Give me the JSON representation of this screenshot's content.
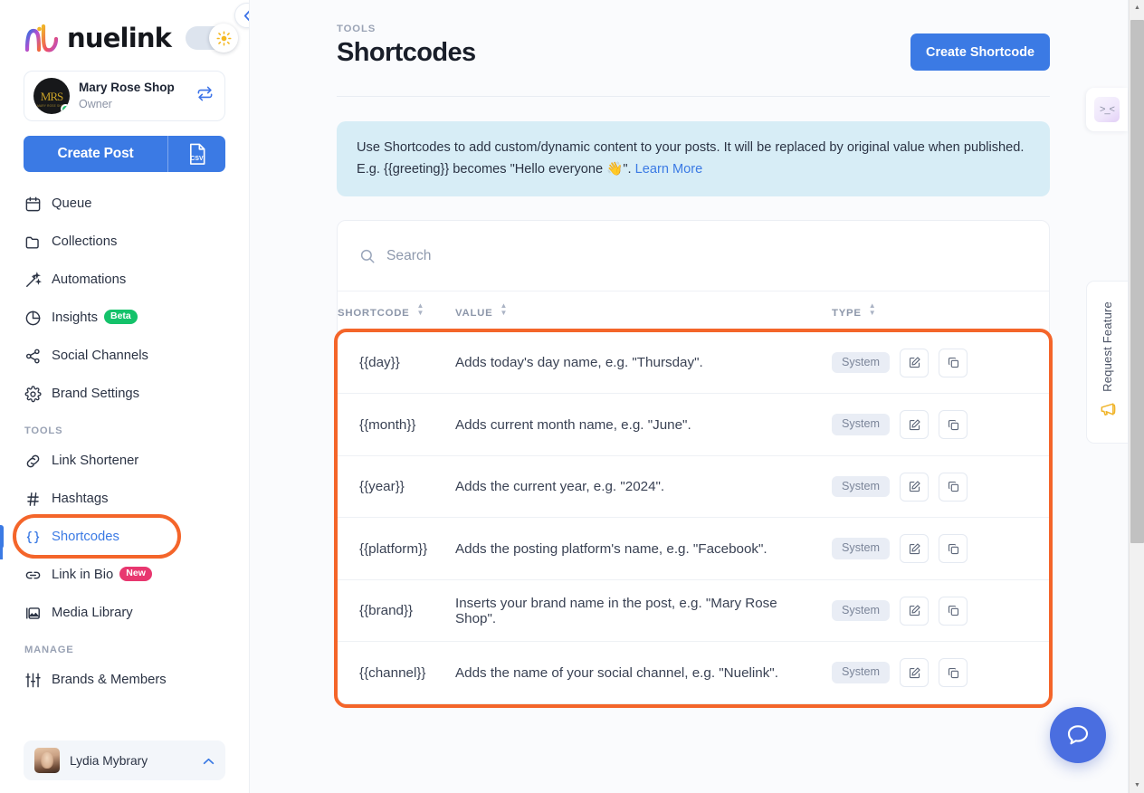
{
  "sidebar": {
    "brand": {
      "name": "nuelink",
      "logo_icon": "nuelink-logo"
    },
    "theme_toggle": {
      "icon": "sun-icon",
      "state": "light"
    },
    "collapse_button": {
      "icon": "chevron-left-icon"
    },
    "account": {
      "name": "Mary Rose Shop",
      "role": "Owner",
      "avatar_initials": "MRS",
      "avatar_sub": "MARY ROSE SHOP",
      "switch_icon": "switch-account-icon",
      "status": "online"
    },
    "create_post": {
      "label": "Create Post",
      "csv_icon": "csv-file-icon"
    },
    "items": [
      {
        "label": "Queue",
        "icon": "calendar-icon"
      },
      {
        "label": "Collections",
        "icon": "folder-icon"
      },
      {
        "label": "Automations",
        "icon": "magic-wand-icon"
      },
      {
        "label": "Insights",
        "icon": "pie-chart-icon",
        "badge": "Beta",
        "badge_color": "#14c26a"
      },
      {
        "label": "Social Channels",
        "icon": "share-nodes-icon"
      },
      {
        "label": "Brand Settings",
        "icon": "gear-icon"
      }
    ],
    "tools_section": "TOOLS",
    "tools_items": [
      {
        "label": "Link Shortener",
        "icon": "link-icon"
      },
      {
        "label": "Hashtags",
        "icon": "hashtag-icon"
      },
      {
        "label": "Shortcodes",
        "icon": "curly-braces-icon",
        "active": true
      },
      {
        "label": "Link in Bio",
        "icon": "chain-link-icon",
        "badge": "New",
        "badge_color": "#e8376f"
      },
      {
        "label": "Media Library",
        "icon": "image-library-icon"
      }
    ],
    "manage_section": "MANAGE",
    "manage_items": [
      {
        "label": "Brands & Members",
        "icon": "sliders-icon"
      }
    ],
    "user": {
      "name": "Lydia Mybrary",
      "caret_icon": "chevron-up-icon",
      "avatar": "user-photo"
    }
  },
  "header": {
    "eyebrow": "TOOLS",
    "title": "Shortcodes",
    "create_button": "Create Shortcode"
  },
  "banner": {
    "text_before": "Use Shortcodes to add custom/dynamic content to your posts. It will be replaced by original value when published. E.g. {{greeting}} becomes \"Hello everyone ",
    "emoji": "👋",
    "text_after": "\". ",
    "link_label": "Learn More"
  },
  "search": {
    "placeholder": "Search",
    "value": "",
    "icon": "search-icon"
  },
  "table": {
    "columns": [
      {
        "key": "shortcode",
        "label": "SHORTCODE",
        "sortable": true
      },
      {
        "key": "value",
        "label": "VALUE",
        "sortable": true
      },
      {
        "key": "type",
        "label": "TYPE",
        "sortable": true
      }
    ],
    "rows": [
      {
        "shortcode": "{{day}}",
        "value": "Adds today's day name, e.g. \"Thursday\".",
        "type": "System",
        "actions": [
          "edit-icon",
          "copy-icon"
        ]
      },
      {
        "shortcode": "{{month}}",
        "value": "Adds current month name, e.g. \"June\".",
        "type": "System",
        "actions": [
          "edit-icon",
          "copy-icon"
        ]
      },
      {
        "shortcode": "{{year}}",
        "value": "Adds the current year, e.g. \"2024\".",
        "type": "System",
        "actions": [
          "edit-icon",
          "copy-icon"
        ]
      },
      {
        "shortcode": "{{platform}}",
        "value": "Adds the posting platform's name, e.g. \"Facebook\".",
        "type": "System",
        "actions": [
          "edit-icon",
          "copy-icon"
        ]
      },
      {
        "shortcode": "{{brand}}",
        "value": "Inserts your brand name in the post, e.g. \"Mary Rose Shop\".",
        "type": "System",
        "actions": [
          "edit-icon",
          "copy-icon"
        ]
      },
      {
        "shortcode": "{{channel}}",
        "value": "Adds the name of your social channel, e.g. \"Nuelink\".",
        "type": "System",
        "actions": [
          "edit-icon",
          "copy-icon"
        ]
      }
    ]
  },
  "rail": {
    "chip_icon": "kaomoji-icon",
    "chip_label": ">_<",
    "request_feature": {
      "label": "Request Feature",
      "icon": "megaphone-icon"
    },
    "help_fab": {
      "icon": "chat-bubble-icon"
    }
  },
  "highlights": {
    "color": "#f4652a",
    "targets": [
      "sidebar-item-shortcodes",
      "shortcodes-table"
    ]
  },
  "colors": {
    "accent": "#3b7ae4",
    "highlight": "#f4652a",
    "banner_bg": "#d7edf6",
    "page_bg": "#fafbfd",
    "badge_beta": "#14c26a",
    "badge_new": "#e8376f"
  }
}
